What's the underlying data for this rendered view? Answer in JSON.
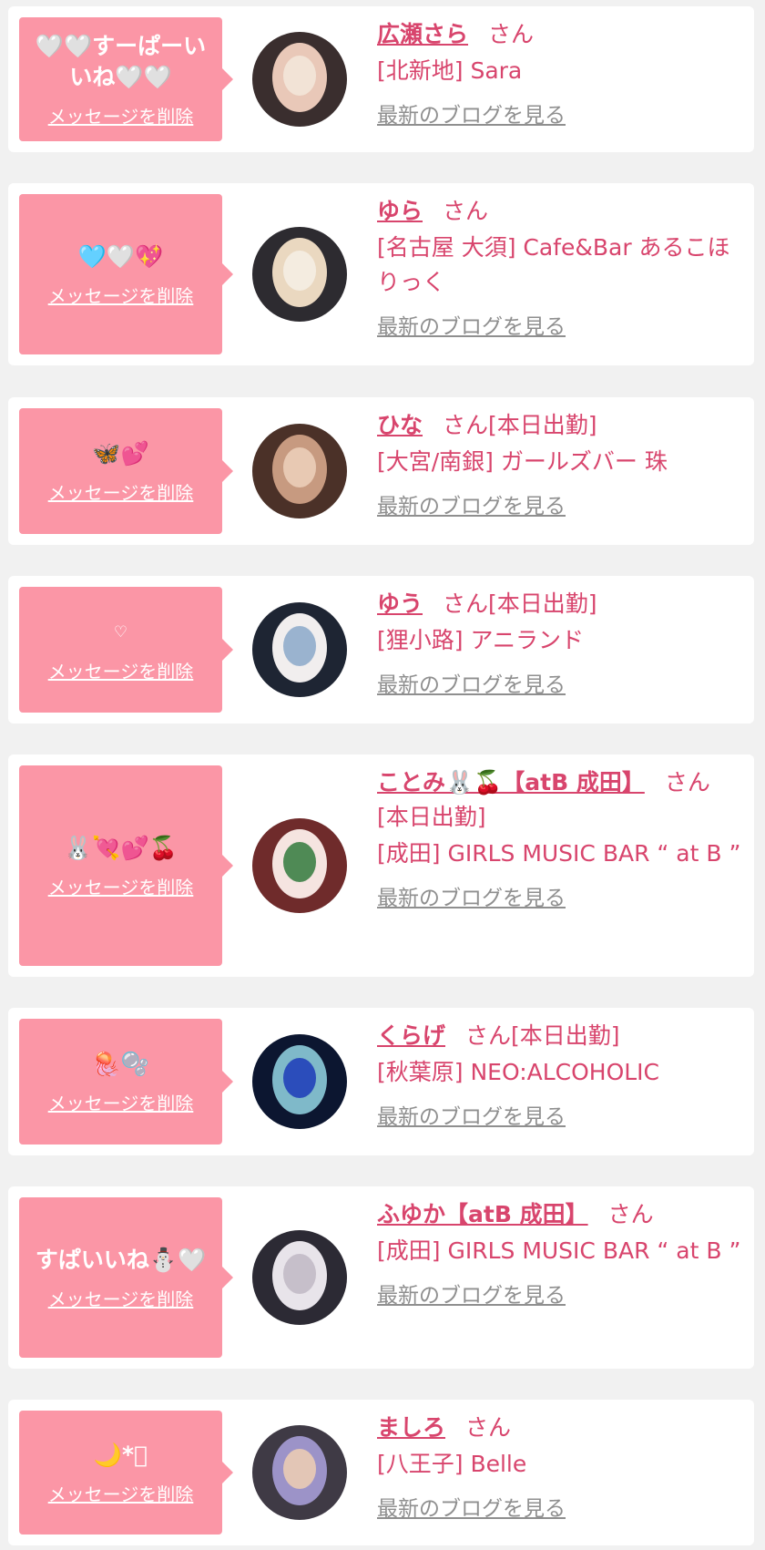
{
  "accent_color": "#d8456d",
  "bubble_color": "#fb96a6",
  "delete_label": "メッセージを削除",
  "blog_label": "最新のブログを見る",
  "items": [
    {
      "message": "🤍🤍すーぱーいいね🤍🤍",
      "name": "広瀬さら",
      "san": "さん",
      "status": "",
      "shop": "[北新地] Sara",
      "avatar_colors": [
        "#3a2e2e",
        "#e9c8b8",
        "#f2e3d6"
      ]
    },
    {
      "message": "🩵🤍💖",
      "name": "ゆら",
      "san": "さん",
      "status": "",
      "shop": "[名古屋 大須] Cafe&Bar あるこほりっく",
      "avatar_colors": [
        "#2d2b30",
        "#ead8c0",
        "#f4ece0"
      ]
    },
    {
      "message": "🦋💕",
      "name": "ひな",
      "san": "さん",
      "status": "[本日出勤]",
      "shop": "[大宮/南銀] ガールズバー 珠",
      "avatar_colors": [
        "#4b3128",
        "#c79a80",
        "#e8c9b3"
      ]
    },
    {
      "message": "♡",
      "name": "ゆう",
      "san": "さん",
      "status": "[本日出勤]",
      "shop": "[狸小路] アニランド",
      "avatar_colors": [
        "#1e2533",
        "#f1eeee",
        "#9ab3cf"
      ]
    },
    {
      "message": "🐰💘💕🍒",
      "name": "ことみ🐰🍒【atB 成田】",
      "san": "さん",
      "status": "[本日出勤]",
      "shop": "[成田] GIRLS MUSIC BAR “ at B ”",
      "avatar_colors": [
        "#6f2b2b",
        "#f5e4e0",
        "#4f8a55"
      ]
    },
    {
      "message": "🪼🫧",
      "name": "くらげ",
      "san": "さん",
      "status": "[本日出勤]",
      "shop": "[秋葉原] NEO:ALCOHOLIC",
      "avatar_colors": [
        "#0c1630",
        "#7fb9c9",
        "#2b4dbb"
      ]
    },
    {
      "message": "すぱいいね⛄️🤍",
      "name": "ふゆか【atB 成田】",
      "san": "さん",
      "status": "",
      "shop": "[成田] GIRLS MUSIC BAR “ at B ”",
      "avatar_colors": [
        "#2c2a34",
        "#e8e4ea",
        "#c6bfca"
      ]
    },
    {
      "message": "🌙*ﾟ",
      "name": "ましろ",
      "san": "さん",
      "status": "",
      "shop": "[八王子] Belle",
      "avatar_colors": [
        "#3f3a45",
        "#9c93c8",
        "#e3c6b6"
      ]
    }
  ]
}
